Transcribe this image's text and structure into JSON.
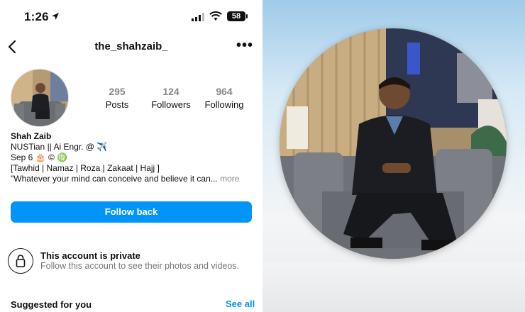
{
  "status_bar": {
    "time": "1:26",
    "battery": "58"
  },
  "header": {
    "username": "the_shahzaib_",
    "back_icon": "chevron-left-icon",
    "more_icon": "more-horizontal-icon"
  },
  "stats": [
    {
      "value": "295",
      "label": "Posts"
    },
    {
      "value": "124",
      "label": "Followers"
    },
    {
      "value": "964",
      "label": "Following"
    }
  ],
  "bio": {
    "name": "Shah Zaib",
    "line1": "NUSTian || Ai Engr. @ ✈️",
    "line2": "Sep 6 🎂 © ♍",
    "line3": "[Tawhid | Namaz | Roza | Zakaat | Hajj ]",
    "line4": "\"Whatever your mind can conceive and believe it can...",
    "more": "more"
  },
  "actions": {
    "follow_back": "Follow back"
  },
  "private": {
    "title": "This account is private",
    "subtitle": "Follow this account to see their photos and videos."
  },
  "suggested": {
    "title": "Suggested for you",
    "see_all": "See all"
  },
  "colors": {
    "accent": "#0095f6",
    "muted": "#888888"
  }
}
